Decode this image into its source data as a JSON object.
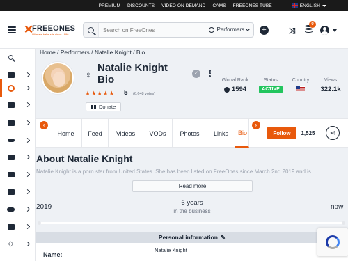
{
  "topbar": {
    "links": [
      "PREMIUM",
      "DISCOUNTS",
      "VIDEO ON DEMAND",
      "CAMS",
      "FREEONES TUBE"
    ],
    "language": "ENGLISH"
  },
  "header": {
    "logo_word": "FREEONES",
    "logo_tagline": "Ultimate babe site since 1996",
    "search_placeholder": "Search on FreeOnes",
    "search_scope": "Performers",
    "notifications_count": "0"
  },
  "breadcrumb": "Home / Performers / Natalie Knight / Bio",
  "profile": {
    "name": "Natalie Knight Bio",
    "rating_stars": "★★★★★",
    "rating": "5",
    "votes": "(6,648 votes)",
    "donate_label": "Donate"
  },
  "stats": {
    "global_rank_label": "Global Rank",
    "global_rank": "1594",
    "status_label": "Status",
    "status": "ACTIVE",
    "country_label": "Country",
    "views_label": "Views",
    "views": "322.1k"
  },
  "tabs": {
    "items": [
      "Home",
      "Feed",
      "Videos",
      "VODs",
      "Photos",
      "Links",
      "Bio"
    ],
    "follow_label": "Follow",
    "follow_count": "1,525"
  },
  "about": {
    "title": "About Natalie Knight",
    "text": "Natalie Knight is a porn star from United States. She has been listed on FreeOnes since March 2nd 2019 and is",
    "read_more": "Read more"
  },
  "career": {
    "start": "2019",
    "end": "now",
    "years": "6 years",
    "caption": "in the business"
  },
  "personal_info": {
    "title": "Personal information",
    "name_label": "Name:",
    "name_value": "Natalie Knight"
  },
  "colors": {
    "accent": "#e8590c",
    "status_active": "#22c55e"
  }
}
